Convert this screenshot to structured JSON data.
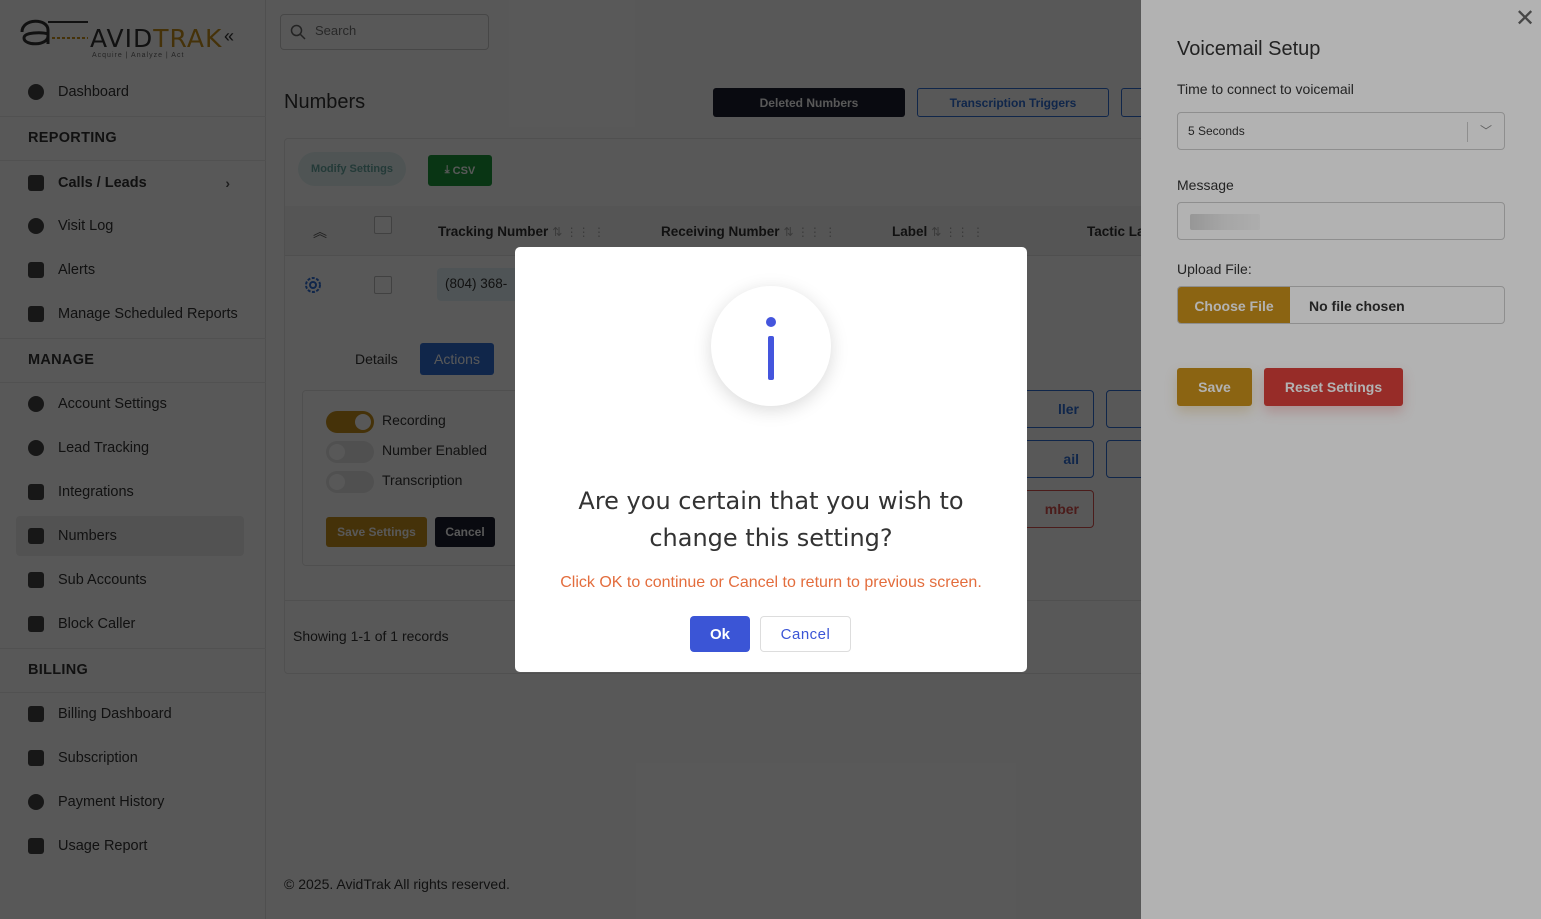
{
  "brand": {
    "logo_word_a": "AVID",
    "logo_word_b": "TRAK",
    "tagline": "Acquire  |  Analyze  |  Act"
  },
  "sidebar": {
    "items": [
      {
        "label": "Dashboard",
        "icon": "dashboard-icon"
      },
      {
        "section": "REPORTING"
      },
      {
        "label": "Calls / Leads",
        "icon": "phone-icon"
      },
      {
        "label": "Visit Log",
        "icon": "globe-icon"
      },
      {
        "label": "Alerts",
        "icon": "alert-icon"
      },
      {
        "label": "Manage Scheduled Reports",
        "icon": "calendar-icon"
      },
      {
        "section": "MANAGE"
      },
      {
        "label": "Account Settings",
        "icon": "gear-icon"
      },
      {
        "label": "Lead Tracking",
        "icon": "pie-chart-icon"
      },
      {
        "label": "Integrations",
        "icon": "grid-icon"
      },
      {
        "label": "Numbers",
        "icon": "hash-icon"
      },
      {
        "label": "Sub Accounts",
        "icon": "users-icon"
      },
      {
        "label": "Block Caller",
        "icon": "user-block-icon"
      },
      {
        "section": "BILLING"
      },
      {
        "label": "Billing Dashboard",
        "icon": "card-icon"
      },
      {
        "label": "Subscription",
        "icon": "subscription-icon"
      },
      {
        "label": "Payment History",
        "icon": "dollar-icon"
      },
      {
        "label": "Usage Report",
        "icon": "report-icon"
      }
    ]
  },
  "search": {
    "placeholder": "Search"
  },
  "main": {
    "title": "Numbers",
    "deleted_numbers": "Deleted Numbers",
    "transcription_triggers": "Transcription Triggers",
    "modify_settings": "Modify Settings",
    "csv": "CSV",
    "columns": [
      "Tracking Number",
      "Receiving Number",
      "Label",
      "Tactic La"
    ],
    "row": {
      "tracking_number": "(804) 368-"
    },
    "tabs": {
      "details": "Details",
      "actions": "Actions"
    },
    "toggles": [
      {
        "label": "Recording",
        "on": true
      },
      {
        "label": "Number Enabled",
        "on": false
      },
      {
        "label": "Transcription",
        "on": false
      }
    ],
    "save_settings": "Save Settings",
    "cancel": "Cancel",
    "action_buttons": [
      "ller",
      "ail",
      "mber"
    ],
    "showing": "Showing 1-1 of 1 records",
    "footer": "© 2025. AvidTrak All rights reserved."
  },
  "drawer": {
    "title": "Voicemail Setup",
    "time_label": "Time to connect to voicemail",
    "time_value": "5 Seconds",
    "message_label": "Message",
    "upload_label": "Upload File:",
    "choose_file": "Choose File",
    "no_file": "No file chosen",
    "save": "Save",
    "reset": "Reset Settings"
  },
  "modal": {
    "title": "Are you certain that you wish to change this setting?",
    "text": "Click OK to continue or Cancel to return to previous screen.",
    "ok": "Ok",
    "cancel": "Cancel"
  },
  "colors": {
    "accent_gold": "#c8901a",
    "primary_blue": "#2f6fd6",
    "modal_blue": "#3b55d6",
    "danger_red": "#d9403a",
    "warning_orange": "#e36d3d"
  }
}
